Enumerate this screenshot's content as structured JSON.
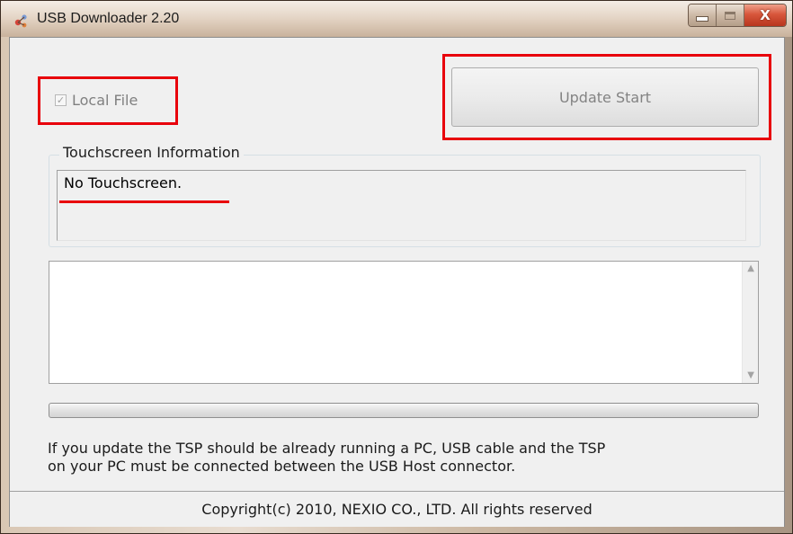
{
  "window": {
    "title": "USB Downloader 2.20",
    "controls": {
      "minimize_icon": "minimize-icon",
      "maximize_icon": "maximize-icon",
      "close_glyph": "X"
    }
  },
  "options": {
    "local_file_label": "Local File",
    "local_file_checked": true,
    "local_file_check_glyph": "✓"
  },
  "toolbar": {
    "update_start_label": "Update Start"
  },
  "touchscreen": {
    "group_label": "Touchscreen Information",
    "info_text": "No Touchscreen."
  },
  "log": {
    "content": ""
  },
  "progress": {
    "fraction": 0
  },
  "notice": {
    "line1": "If you update the TSP should be already running a PC, USB cable and the TSP",
    "line2": "on your PC must be connected between the USB Host connector."
  },
  "footer": {
    "copyright": "Copyright(c) 2010, NEXIO CO., LTD. All rights reserved"
  },
  "colors": {
    "highlight": "#e8000b",
    "client_bg": "#f0f0f0",
    "disabled_text": "#808080"
  }
}
